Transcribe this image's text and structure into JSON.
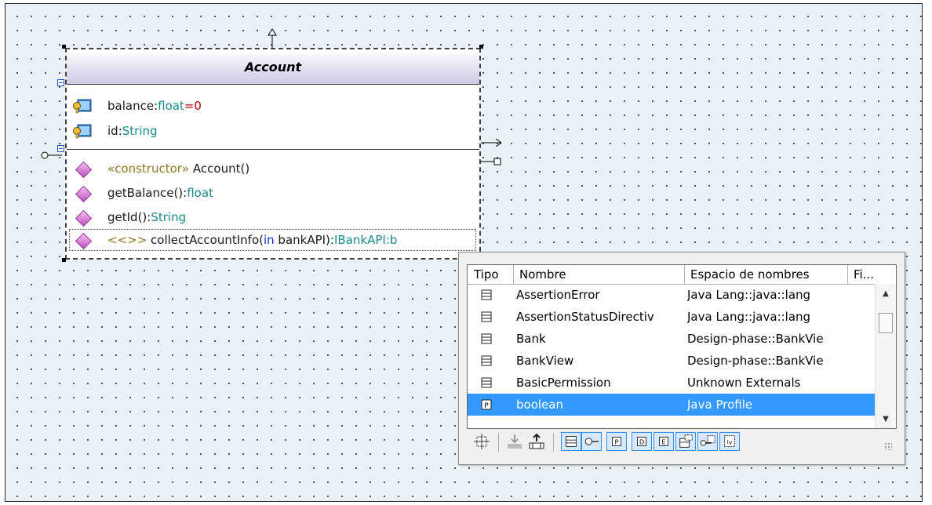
{
  "diagram": {
    "class": {
      "name": "Account",
      "attributes": [
        {
          "name": "balance",
          "sep": ":",
          "type": "float",
          "default_sep": "=",
          "default": "0"
        },
        {
          "name": "id",
          "sep": ":",
          "type": "String"
        }
      ],
      "operations": [
        {
          "stereotype": "«constructor»",
          "name": " Account()"
        },
        {
          "name": "getBalance()",
          "sep": ":",
          "type": "float"
        },
        {
          "name": "getId()",
          "sep": ":",
          "type": "String"
        },
        {
          "prefix": "<<>> ",
          "name": "collectAccountInfo(",
          "param_dir": "in",
          "param": " bankAPI)",
          "sep": ":",
          "type": "IBankAPI:b"
        }
      ]
    }
  },
  "popup": {
    "columns": [
      "Tipo",
      "Nombre",
      "Espacio de nombres",
      "Fi..."
    ],
    "rows": [
      {
        "icon": "class-icon",
        "name": "AssertionError",
        "namespace": "Java Lang::java::lang"
      },
      {
        "icon": "class-icon",
        "name": "AssertionStatusDirectiv",
        "namespace": "Java Lang::java::lang"
      },
      {
        "icon": "class-icon",
        "name": "Bank",
        "namespace": "Design-phase::BankVie"
      },
      {
        "icon": "class-icon",
        "name": "BankView",
        "namespace": "Design-phase::BankVie"
      },
      {
        "icon": "class-icon",
        "name": "BasicPermission",
        "namespace": "Unknown Externals"
      },
      {
        "icon": "primitive-icon",
        "name": "boolean",
        "namespace": "Java Profile",
        "selected": true
      }
    ],
    "toolbar": [
      "show-diagram-icon",
      "import-icon",
      "export-icon",
      "class-filter-icon",
      "interface-filter-icon",
      "primitive-filter-icon",
      "datatype-filter-icon",
      "enumeration-filter-icon",
      "template-filter-icon",
      "port-filter-icon",
      "value-filter-icon"
    ],
    "colors": {
      "selection": "#3399ff",
      "toggle_border": "#3a8ee6"
    }
  }
}
